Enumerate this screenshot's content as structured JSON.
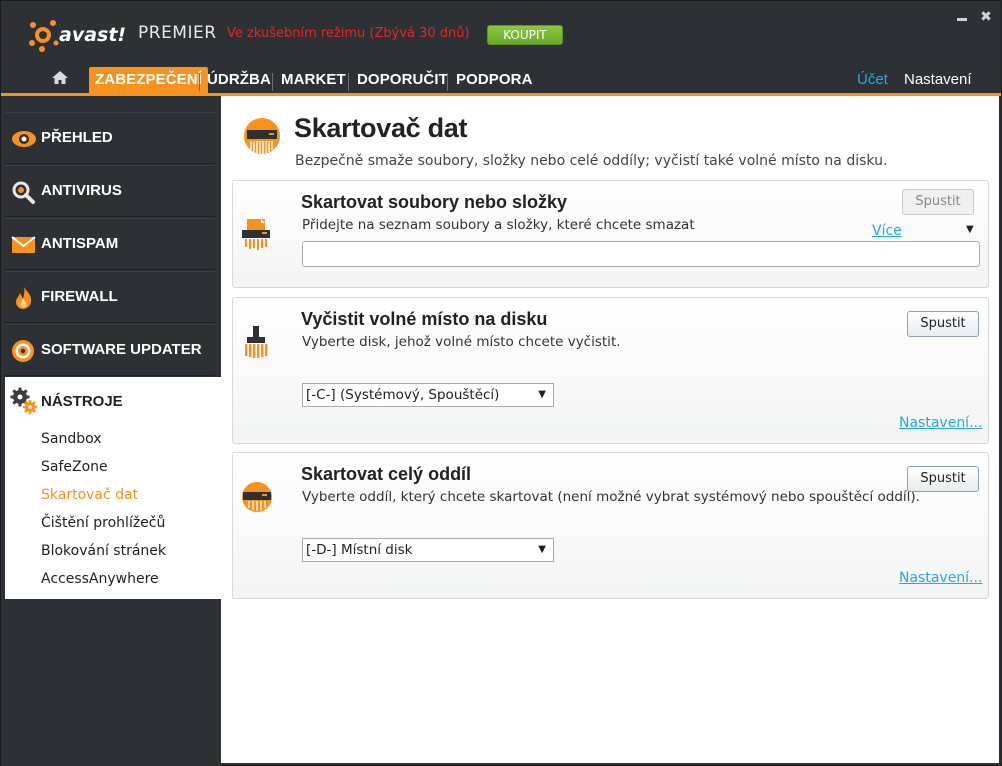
{
  "titlebar": {
    "brand": "avast!",
    "product": "PREMIER",
    "trial_text": "Ve zkušebním režimu (Zbývá 30 dnů)",
    "buy_label": "KOUPIT",
    "minimize_glyph": "▬",
    "close_glyph": "✖"
  },
  "nav": {
    "tabs": [
      {
        "label": "ZABEZPEČENÍ",
        "active": true
      },
      {
        "label": "ÚDRŽBA"
      },
      {
        "label": "MARKET"
      },
      {
        "label": "DOPORUČIT"
      },
      {
        "label": "PODPORA"
      }
    ],
    "account": "Účet",
    "settings": "Nastavení"
  },
  "sidebar": {
    "items": [
      {
        "label": "PŘEHLED",
        "icon": "eye-icon"
      },
      {
        "label": "ANTIVIRUS",
        "icon": "magnifier-icon"
      },
      {
        "label": "ANTISPAM",
        "icon": "envelope-icon"
      },
      {
        "label": "FIREWALL",
        "icon": "flame-icon"
      },
      {
        "label": "SOFTWARE UPDATER",
        "icon": "target-icon"
      }
    ],
    "tools": {
      "label": "NÁSTROJE",
      "icon": "gears-icon",
      "subitems": [
        {
          "label": "Sandbox"
        },
        {
          "label": "SafeZone"
        },
        {
          "label": "Skartovač dat",
          "active": true
        },
        {
          "label": "Čištění prohlížečů"
        },
        {
          "label": "Blokování stránek"
        },
        {
          "label": "AccessAnywhere"
        }
      ]
    }
  },
  "main": {
    "title": "Skartovač dat",
    "subtitle": "Bezpečně smaže soubory, složky nebo celé oddíly; vyčistí také volné místo na disku.",
    "panels": [
      {
        "title": "Skartovat soubory nebo složky",
        "desc": "Přidejte na seznam soubory a složky, které chcete smazat",
        "button": "Spustit",
        "button_disabled": true,
        "more_link": "Více",
        "input_value": ""
      },
      {
        "title": "Vyčistit volné místo na disku",
        "desc": "Vyberte disk, jehož volné místo chcete vyčistit.",
        "button": "Spustit",
        "select_value": "[-C-] (Systémový, Spouštěcí)",
        "settings_link": "Nastavení..."
      },
      {
        "title": "Skartovat celý oddíl",
        "desc": "Vyberte oddíl, který chcete skartovat (není možné vybrat systémový nebo spouštěcí oddíl).",
        "button": "Spustit",
        "select_value": "[-D-] Místní disk",
        "settings_link": "Nastavení..."
      }
    ]
  },
  "colors": {
    "accent": "#f7921e",
    "link": "#2aa7df",
    "trial": "#e0282a",
    "buy": "#7ab833",
    "chrome": "#2d3035"
  }
}
